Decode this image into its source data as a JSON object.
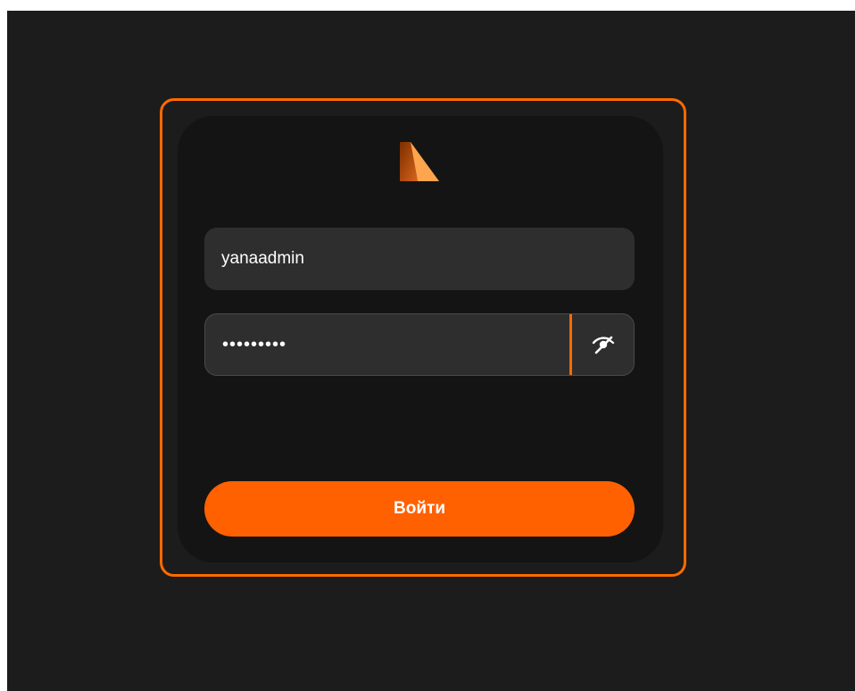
{
  "login": {
    "username_value": "yanaadmin",
    "password_masked": "•••••••••",
    "submit_label": "Войти",
    "toggle_icon": "eye-slash-icon",
    "logo_icon": "brand-logo"
  },
  "colors": {
    "accent": "#ff6100",
    "frame": "#ff6a00",
    "background": "#1c1c1c",
    "card": "#141414",
    "field": "#2e2e2e",
    "text": "#ffffff"
  }
}
